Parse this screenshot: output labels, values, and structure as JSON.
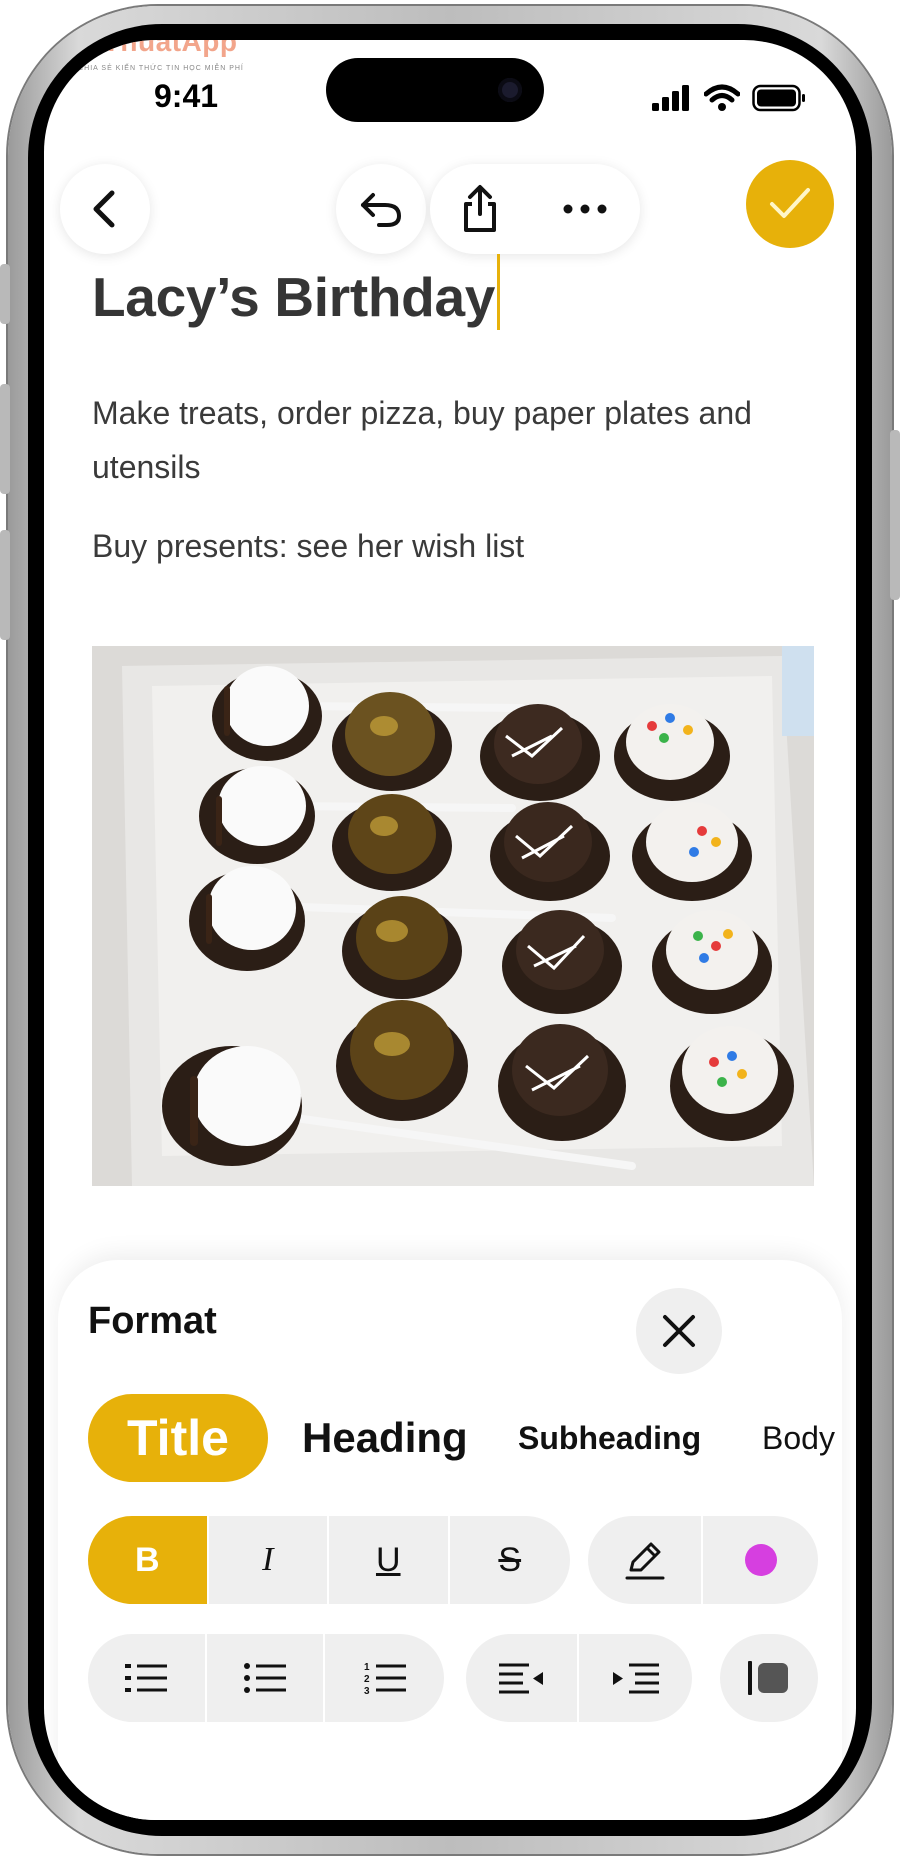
{
  "watermark": {
    "brand": "ThuThuatApp",
    "tagline": "CHIA SẺ KIẾN THỨC TIN HỌC MIỄN PHÍ"
  },
  "status_bar": {
    "time": "9:41"
  },
  "toolbar": {
    "back_icon": "chevron-left-icon",
    "undo_icon": "undo-icon",
    "share_icon": "share-icon",
    "more_icon": "ellipsis-icon",
    "done_icon": "checkmark-icon"
  },
  "note": {
    "title": "Lacy’s Birthday",
    "paragraph1": "Make treats, order pizza, buy paper plates and utensils",
    "paragraph2": "Buy presents: see her wish list"
  },
  "format_panel": {
    "title": "Format",
    "styles": [
      "Title",
      "Heading",
      "Subheading",
      "Body"
    ],
    "selected_style": "Title",
    "text_buttons": {
      "bold": "B",
      "italic": "I",
      "underline": "U",
      "strikethrough": "S"
    },
    "selected_text_button": "B",
    "highlight_color": "#d63fe0"
  },
  "colors": {
    "accent": "#e7b10a"
  }
}
